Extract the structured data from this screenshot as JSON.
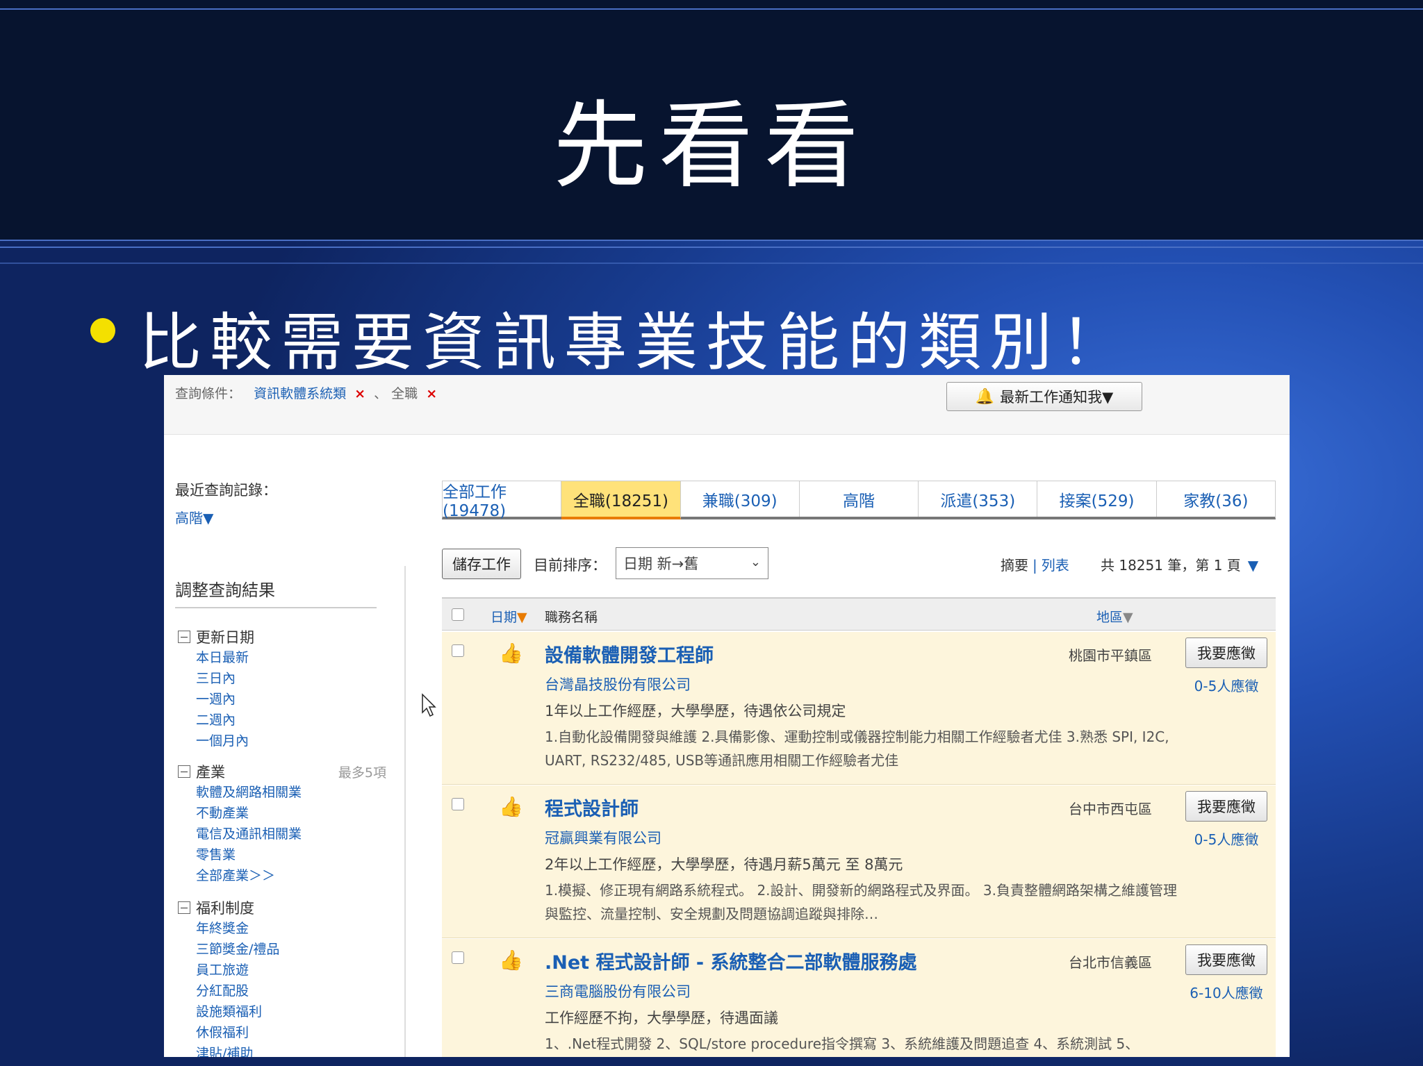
{
  "slide": {
    "title": "先看看",
    "bullet": "比較需要資訊專業技能的類別！"
  },
  "search": {
    "criteria_label": "查詢條件：",
    "category": "資訊軟體系統類",
    "separator": "、",
    "jobtype": "全職",
    "remove_symbol": "×"
  },
  "notify": {
    "label": "最新工作通知我▼"
  },
  "recent": {
    "label": "最近查詢記錄：",
    "link": "高階▼"
  },
  "adjust": {
    "title": "調整查詢結果"
  },
  "filters": [
    {
      "title": "更新日期",
      "note": "",
      "items": [
        "本日最新",
        "三日內",
        "一週內",
        "二週內",
        "一個月內"
      ]
    },
    {
      "title": "產業",
      "note": "最多5項",
      "items": [
        "軟體及網路相關業",
        "不動產業",
        "電信及通訊相關業",
        "零售業",
        "全部產業＞＞"
      ]
    },
    {
      "title": "福利制度",
      "note": "",
      "items": [
        "年終獎金",
        "三節獎金/禮品",
        "員工旅遊",
        "分紅配股",
        "設施類福利",
        "休假福利",
        "津貼/補助"
      ]
    }
  ],
  "tabs": [
    {
      "label": "全部工作(19478)",
      "active": false
    },
    {
      "label": "全職(18251)",
      "active": true
    },
    {
      "label": "兼職(309)",
      "active": false
    },
    {
      "label": "高階",
      "active": false
    },
    {
      "label": "派遣(353)",
      "active": false
    },
    {
      "label": "接案(529)",
      "active": false
    },
    {
      "label": "家教(36)",
      "active": false
    }
  ],
  "toolbar": {
    "save_label": "儲存工作",
    "sort_label": "目前排序：",
    "sort_value": "日期 新→舊",
    "view_summary": "摘要",
    "view_sep": "|",
    "view_list": "列表",
    "page_info": "共 18251 筆，第 1 頁",
    "page_arrow": "▼"
  },
  "list_header": {
    "date": "日期",
    "date_arrow": "▼",
    "title": "職務名稱",
    "area": "地區",
    "area_arrow": "▼"
  },
  "jobs": [
    {
      "title": "設備軟體開發工程師",
      "company": "台灣晶技股份有限公司",
      "summary": "1年以上工作經歷，大學學歷，待遇依公司規定",
      "desc": "1.自動化設備開發與維護 2.具備影像、運動控制或儀器控制能力相關工作經驗者尤佳 3.熟悉 SPI, I2C, UART, RS232/485, USB等通訊應用相關工作經驗者尤佳",
      "area": "桃園市平鎮區",
      "apply": "我要應徵",
      "applicants": "0-5人應徵"
    },
    {
      "title": "程式設計師",
      "company": "冠贏興業有限公司",
      "summary": "2年以上工作經歷，大學學歷，待遇月薪5萬元 至 8萬元",
      "desc": "1.模擬、修正現有網路系統程式。 2.設計、開發新的網路程式及界面。 3.負責整體網路架構之維護管理與監控、流量控制、安全規劃及問題協調追蹤與排除…",
      "area": "台中市西屯區",
      "apply": "我要應徵",
      "applicants": "0-5人應徵"
    },
    {
      "title": ".Net 程式設計師 - 系統整合二部軟體服務處",
      "company": "三商電腦股份有限公司",
      "summary": "工作經歷不拘，大學學歷，待遇面議",
      "desc": "1、.Net程式開發 2、SQL/store procedure指令撰寫 3、系統維護及問題追查 4、系統測試 5、",
      "area": "台北市信義區",
      "apply": "我要應徵",
      "applicants": "6-10人應徵"
    }
  ]
}
